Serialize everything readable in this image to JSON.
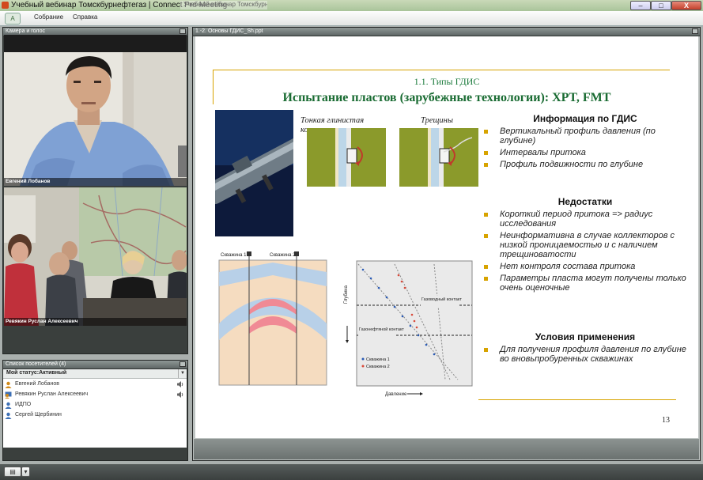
{
  "window": {
    "title": "Учебный вебинар Томскбурнефтегаз | Connect Pro Meeting",
    "ghost_tab": "Учебный вебинар Томскбурнефтегаз",
    "buttons": {
      "minimize": "–",
      "maximize": "□",
      "close": "X"
    }
  },
  "menu": {
    "logo": "A",
    "items": [
      "Собрание",
      "Справка"
    ]
  },
  "camera_pod": {
    "title": "Камера и голос",
    "videos": [
      {
        "name": "Евгений Лобанов"
      },
      {
        "name": "Ревякин Руслан Алексеевич"
      }
    ]
  },
  "attendees_pod": {
    "title": "Список посетителей (4)",
    "my_status": "Мой статус:Активный",
    "attendees": [
      {
        "name": "Евгений Лобанов",
        "role": "host",
        "speaking": true
      },
      {
        "name": "Ревякин Руслан Алексеевич",
        "role": "presenter",
        "speaking": true
      },
      {
        "name": "ИДПО",
        "role": "participant",
        "speaking": false
      },
      {
        "name": "Сергей Щербинин",
        "role": "participant",
        "speaking": false
      }
    ]
  },
  "share_pod": {
    "title": "1.-2. Основы ГДИС_Sh.ppt"
  },
  "slide": {
    "subtitle": "1.1. Типы ГДИС",
    "title": "Испытание пластов (зарубежные технологии): XPT, FMT",
    "captions": {
      "mudcake": "Тонкая глинистая корка",
      "fractures": "Трещины"
    },
    "sections": [
      {
        "heading": "Информация по ГДИС",
        "bullets": [
          "Вертикальный профиль давления (по глубине)",
          "Интервалы притока",
          "Профиль подвижности по глубине"
        ]
      },
      {
        "heading": "Недостатки",
        "bullets": [
          "Короткий период притока => радиус исследования",
          "Неинформативна в случае коллекторов с низкой проницаемостью и с наличием трещиноватости",
          "Нет контроля состава притока",
          "Параметры пласта могут получены только очень оценочные"
        ]
      },
      {
        "heading": "Условия применения",
        "bullets": [
          "Для получения профиля давления по глубине во вновьпробуренных скважинах"
        ]
      }
    ],
    "section_diagram": {
      "well_labels": [
        "Скважина 1",
        "Скважина 2"
      ]
    },
    "pressure_plot": {
      "ylabel": "Глубина",
      "xlabel": "Давление",
      "contacts": [
        "Газоводный контакт",
        "Газонефтяной контакт"
      ],
      "legend": [
        "Скважина 1",
        "Скважина 2"
      ]
    },
    "page_number": "13"
  },
  "colors": {
    "accent": "#d7a300",
    "title_green": "#196b32",
    "bullet": "#d7a300"
  }
}
